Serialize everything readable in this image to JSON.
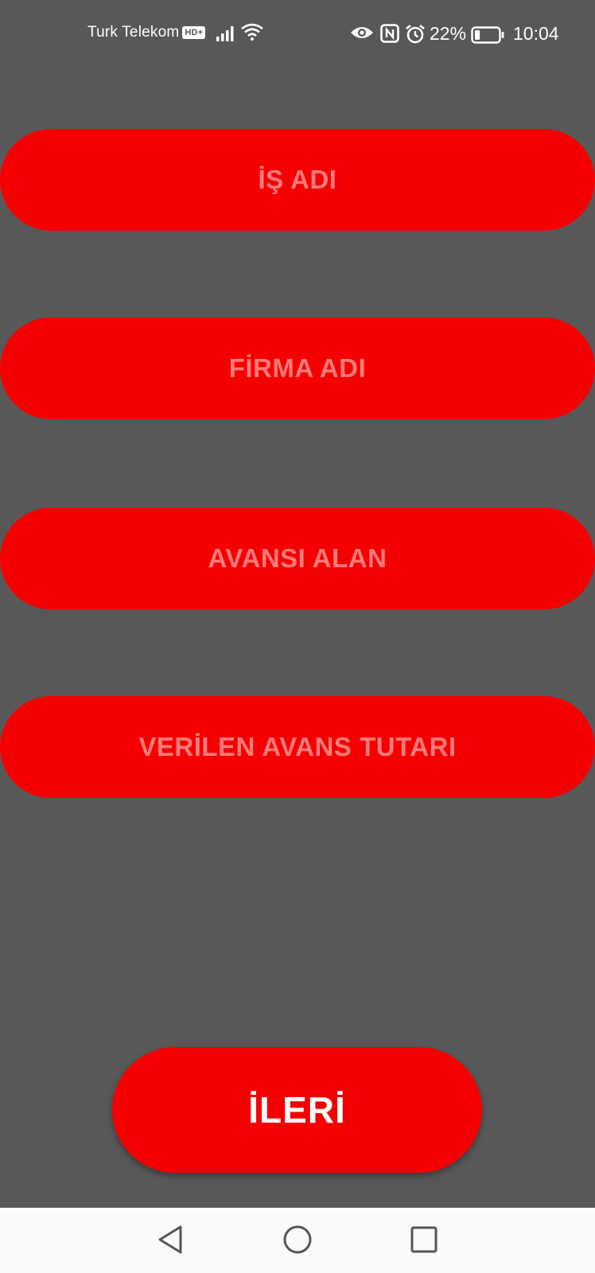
{
  "status_bar": {
    "carrier": "Turk Telekom",
    "hd_badge": "HD+",
    "battery_percent": "22%",
    "time": "10:04",
    "icons": [
      "signal-icon",
      "wifi-icon",
      "eye-icon",
      "nfc-icon",
      "alarm-icon",
      "battery-icon"
    ],
    "battery_level": 0.22
  },
  "form": {
    "fields": [
      {
        "label": "İŞ ADI"
      },
      {
        "label": "FİRMA ADI"
      },
      {
        "label": "AVANSI ALAN"
      },
      {
        "label": "VERİLEN AVANS TUTARI"
      }
    ],
    "next_button": "İLERİ"
  },
  "nav_bar": {
    "icons": [
      "back-icon",
      "home-icon",
      "recent-apps-icon"
    ]
  },
  "colors": {
    "background": "#585858",
    "accent": "#f50000",
    "field_text": "#ff7a7a",
    "button_text": "#ffffff"
  }
}
